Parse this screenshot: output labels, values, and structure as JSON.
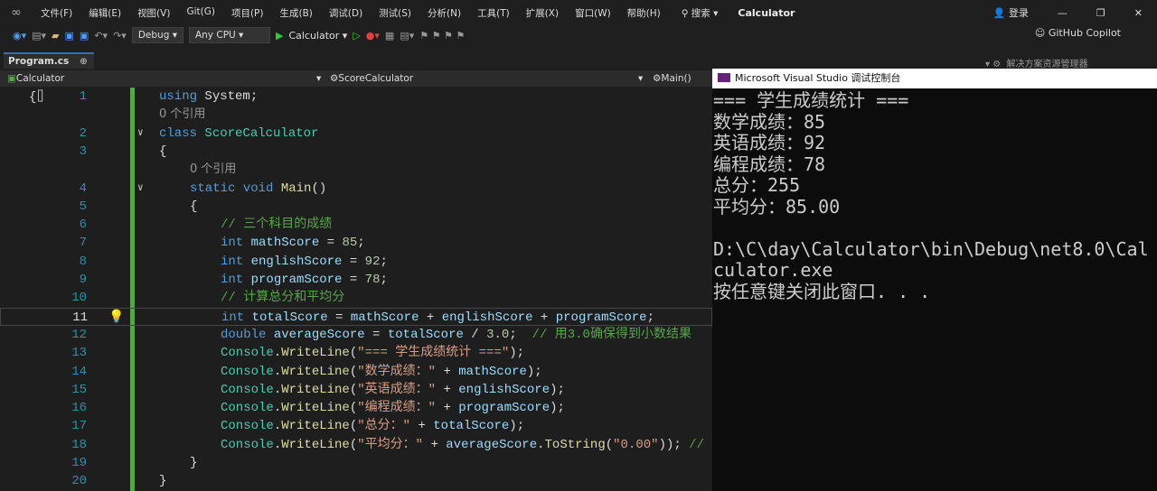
{
  "menu": {
    "items": [
      "文件(F)",
      "编辑(E)",
      "视图(V)",
      "Git(G)",
      "项目(P)",
      "生成(B)",
      "调试(D)",
      "测试(S)",
      "分析(N)",
      "工具(T)",
      "扩展(X)",
      "窗口(W)",
      "帮助(H)"
    ],
    "search": "⚲ 搜索 ▾",
    "title": "Calculator",
    "login": "登录"
  },
  "toolbar": {
    "config": "Debug ▾",
    "platform": "Any CPU ▾",
    "run": "Calculator ▾",
    "copilot": "GitHub Copilot"
  },
  "tab": {
    "label": "Program.cs",
    "pin": "⊕",
    "close": "✕"
  },
  "nav": {
    "project": "Calculator",
    "class": "ScoreCalculator",
    "member": "Main()"
  },
  "solution_explorer": "解决方案资源管理器",
  "code": [
    {
      "n": "1",
      "t": [
        [
          "kw",
          "using"
        ],
        [
          "pl",
          " System;"
        ]
      ]
    },
    {
      "lens": "0 个引用",
      "indent": 0
    },
    {
      "n": "2",
      "fold": true,
      "t": [
        [
          "kw",
          "class"
        ],
        [
          "pl",
          " "
        ],
        [
          "ty",
          "ScoreCalculator"
        ]
      ]
    },
    {
      "n": "3",
      "t": [
        [
          "pl",
          "{"
        ]
      ]
    },
    {
      "lens": "0 个引用",
      "indent": 1
    },
    {
      "n": "4",
      "fold": true,
      "indent": 1,
      "t": [
        [
          "kw",
          "static"
        ],
        [
          "pl",
          " "
        ],
        [
          "kw",
          "void"
        ],
        [
          "pl",
          " "
        ],
        [
          "me",
          "Main"
        ],
        [
          "pl",
          "()"
        ]
      ]
    },
    {
      "n": "5",
      "indent": 1,
      "t": [
        [
          "pl",
          "{"
        ]
      ]
    },
    {
      "n": "6",
      "indent": 2,
      "t": [
        [
          "cm",
          "// 三个科目的成绩"
        ]
      ]
    },
    {
      "n": "7",
      "indent": 2,
      "t": [
        [
          "kw",
          "int"
        ],
        [
          "pl",
          " "
        ],
        [
          "id",
          "mathScore"
        ],
        [
          "pl",
          " = "
        ],
        [
          "nu",
          "85"
        ],
        [
          "pl",
          ";"
        ]
      ]
    },
    {
      "n": "8",
      "indent": 2,
      "t": [
        [
          "kw",
          "int"
        ],
        [
          "pl",
          " "
        ],
        [
          "id",
          "englishScore"
        ],
        [
          "pl",
          " = "
        ],
        [
          "nu",
          "92"
        ],
        [
          "pl",
          ";"
        ]
      ]
    },
    {
      "n": "9",
      "indent": 2,
      "t": [
        [
          "kw",
          "int"
        ],
        [
          "pl",
          " "
        ],
        [
          "id",
          "programScore"
        ],
        [
          "pl",
          " = "
        ],
        [
          "nu",
          "78"
        ],
        [
          "pl",
          ";"
        ]
      ]
    },
    {
      "n": "10",
      "indent": 2,
      "t": [
        [
          "cm",
          "// 计算总分和平均分"
        ]
      ]
    },
    {
      "n": "11",
      "cur": true,
      "indent": 2,
      "t": [
        [
          "kw",
          "int"
        ],
        [
          "pl",
          " "
        ],
        [
          "id",
          "totalScore"
        ],
        [
          "pl",
          " = "
        ],
        [
          "id",
          "mathScore"
        ],
        [
          "pl",
          " + "
        ],
        [
          "id",
          "englishScore"
        ],
        [
          "pl",
          " + "
        ],
        [
          "id",
          "programScore"
        ],
        [
          "pl",
          ";"
        ]
      ]
    },
    {
      "n": "12",
      "indent": 2,
      "t": [
        [
          "kw",
          "double"
        ],
        [
          "pl",
          " "
        ],
        [
          "id",
          "averageScore"
        ],
        [
          "pl",
          " = "
        ],
        [
          "id",
          "totalScore"
        ],
        [
          "pl",
          " / "
        ],
        [
          "nu",
          "3.0"
        ],
        [
          "pl",
          ";  "
        ],
        [
          "cm",
          "// 用3.0确保得到小数结果"
        ]
      ]
    },
    {
      "n": "13",
      "indent": 2,
      "t": [
        [
          "ty",
          "Console"
        ],
        [
          "pl",
          "."
        ],
        [
          "me",
          "WriteLine"
        ],
        [
          "pl",
          "("
        ],
        [
          "st",
          "\"=== 学生成绩统计 ===\""
        ],
        [
          "pl",
          ");"
        ]
      ]
    },
    {
      "n": "14",
      "indent": 2,
      "t": [
        [
          "ty",
          "Console"
        ],
        [
          "pl",
          "."
        ],
        [
          "me",
          "WriteLine"
        ],
        [
          "pl",
          "("
        ],
        [
          "st",
          "\"数学成绩：\""
        ],
        [
          "pl",
          " + "
        ],
        [
          "id",
          "mathScore"
        ],
        [
          "pl",
          ");"
        ]
      ]
    },
    {
      "n": "15",
      "indent": 2,
      "t": [
        [
          "ty",
          "Console"
        ],
        [
          "pl",
          "."
        ],
        [
          "me",
          "WriteLine"
        ],
        [
          "pl",
          "("
        ],
        [
          "st",
          "\"英语成绩：\""
        ],
        [
          "pl",
          " + "
        ],
        [
          "id",
          "englishScore"
        ],
        [
          "pl",
          ");"
        ]
      ]
    },
    {
      "n": "16",
      "indent": 2,
      "t": [
        [
          "ty",
          "Console"
        ],
        [
          "pl",
          "."
        ],
        [
          "me",
          "WriteLine"
        ],
        [
          "pl",
          "("
        ],
        [
          "st",
          "\"编程成绩：\""
        ],
        [
          "pl",
          " + "
        ],
        [
          "id",
          "programScore"
        ],
        [
          "pl",
          ");"
        ]
      ]
    },
    {
      "n": "17",
      "indent": 2,
      "t": [
        [
          "ty",
          "Console"
        ],
        [
          "pl",
          "."
        ],
        [
          "me",
          "WriteLine"
        ],
        [
          "pl",
          "("
        ],
        [
          "st",
          "\"总分：\""
        ],
        [
          "pl",
          " + "
        ],
        [
          "id",
          "totalScore"
        ],
        [
          "pl",
          ");"
        ]
      ]
    },
    {
      "n": "18",
      "indent": 2,
      "t": [
        [
          "ty",
          "Console"
        ],
        [
          "pl",
          "."
        ],
        [
          "me",
          "WriteLine"
        ],
        [
          "pl",
          "("
        ],
        [
          "st",
          "\"平均分：\""
        ],
        [
          "pl",
          " + "
        ],
        [
          "id",
          "averageScore"
        ],
        [
          "pl",
          "."
        ],
        [
          "me",
          "ToString"
        ],
        [
          "pl",
          "("
        ],
        [
          "st",
          "\"0.00\""
        ],
        [
          "pl",
          "));"
        ],
        [
          "cm",
          " //"
        ]
      ]
    },
    {
      "n": "19",
      "indent": 1,
      "t": [
        [
          "pl",
          "}"
        ]
      ]
    },
    {
      "n": "20",
      "t": [
        [
          "pl",
          "}"
        ]
      ]
    }
  ],
  "console": {
    "title": "Microsoft Visual Studio 调试控制台",
    "lines": [
      "=== 学生成绩统计 ===",
      "数学成绩：85",
      "英语成绩：92",
      "编程成绩：78",
      "总分：255",
      "平均分：85.00",
      "",
      "D:\\C\\day\\Calculator\\bin\\Debug\\net8.0\\Calculator.exe",
      "按任意键关闭此窗口. . ."
    ]
  }
}
